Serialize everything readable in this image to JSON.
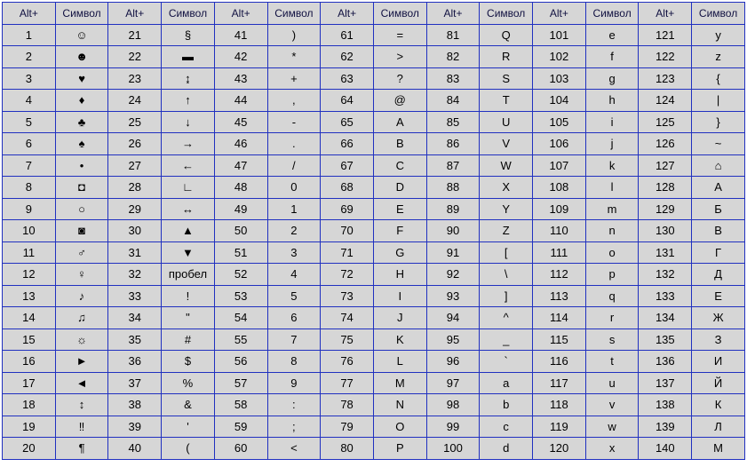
{
  "headers": {
    "code": "Alt+",
    "sym": "Символ"
  },
  "chart_data": {
    "type": "table",
    "title": "",
    "columns": [
      "Alt+",
      "Символ"
    ],
    "column_pairs": 7,
    "rows_per_pair": 20,
    "series": [
      {
        "code": "1",
        "sym": "☺"
      },
      {
        "code": "2",
        "sym": "☻"
      },
      {
        "code": "3",
        "sym": "♥"
      },
      {
        "code": "4",
        "sym": "♦"
      },
      {
        "code": "5",
        "sym": "♣"
      },
      {
        "code": "6",
        "sym": "♠"
      },
      {
        "code": "7",
        "sym": "•"
      },
      {
        "code": "8",
        "sym": "◘"
      },
      {
        "code": "9",
        "sym": "○"
      },
      {
        "code": "10",
        "sym": "◙"
      },
      {
        "code": "11",
        "sym": "♂"
      },
      {
        "code": "12",
        "sym": "♀"
      },
      {
        "code": "13",
        "sym": "♪"
      },
      {
        "code": "14",
        "sym": "♫"
      },
      {
        "code": "15",
        "sym": "☼"
      },
      {
        "code": "16",
        "sym": "►"
      },
      {
        "code": "17",
        "sym": "◄"
      },
      {
        "code": "18",
        "sym": "↕"
      },
      {
        "code": "19",
        "sym": "‼"
      },
      {
        "code": "20",
        "sym": "¶"
      },
      {
        "code": "21",
        "sym": "§"
      },
      {
        "code": "22",
        "sym": "▬"
      },
      {
        "code": "23",
        "sym": "↨"
      },
      {
        "code": "24",
        "sym": "↑"
      },
      {
        "code": "25",
        "sym": "↓"
      },
      {
        "code": "26",
        "sym": "→"
      },
      {
        "code": "27",
        "sym": "←"
      },
      {
        "code": "28",
        "sym": "∟"
      },
      {
        "code": "29",
        "sym": "↔"
      },
      {
        "code": "30",
        "sym": "▲"
      },
      {
        "code": "31",
        "sym": "▼"
      },
      {
        "code": "32",
        "sym": "пробел"
      },
      {
        "code": "33",
        "sym": "!"
      },
      {
        "code": "34",
        "sym": "\""
      },
      {
        "code": "35",
        "sym": "#"
      },
      {
        "code": "36",
        "sym": "$"
      },
      {
        "code": "37",
        "sym": "%"
      },
      {
        "code": "38",
        "sym": "&"
      },
      {
        "code": "39",
        "sym": "'"
      },
      {
        "code": "40",
        "sym": "("
      },
      {
        "code": "41",
        "sym": ")"
      },
      {
        "code": "42",
        "sym": "*"
      },
      {
        "code": "43",
        "sym": "+"
      },
      {
        "code": "44",
        "sym": ","
      },
      {
        "code": "45",
        "sym": "-"
      },
      {
        "code": "46",
        "sym": "."
      },
      {
        "code": "47",
        "sym": "/"
      },
      {
        "code": "48",
        "sym": "0"
      },
      {
        "code": "49",
        "sym": "1"
      },
      {
        "code": "50",
        "sym": "2"
      },
      {
        "code": "51",
        "sym": "3"
      },
      {
        "code": "52",
        "sym": "4"
      },
      {
        "code": "53",
        "sym": "5"
      },
      {
        "code": "54",
        "sym": "6"
      },
      {
        "code": "55",
        "sym": "7"
      },
      {
        "code": "56",
        "sym": "8"
      },
      {
        "code": "57",
        "sym": "9"
      },
      {
        "code": "58",
        "sym": ":"
      },
      {
        "code": "59",
        "sym": ";"
      },
      {
        "code": "60",
        "sym": "<"
      },
      {
        "code": "61",
        "sym": "="
      },
      {
        "code": "62",
        "sym": ">"
      },
      {
        "code": "63",
        "sym": "?"
      },
      {
        "code": "64",
        "sym": "@"
      },
      {
        "code": "65",
        "sym": "A"
      },
      {
        "code": "66",
        "sym": "B"
      },
      {
        "code": "67",
        "sym": "C"
      },
      {
        "code": "68",
        "sym": "D"
      },
      {
        "code": "69",
        "sym": "E"
      },
      {
        "code": "70",
        "sym": "F"
      },
      {
        "code": "71",
        "sym": "G"
      },
      {
        "code": "72",
        "sym": "H"
      },
      {
        "code": "73",
        "sym": "I"
      },
      {
        "code": "74",
        "sym": "J"
      },
      {
        "code": "75",
        "sym": "K"
      },
      {
        "code": "76",
        "sym": "L"
      },
      {
        "code": "77",
        "sym": "M"
      },
      {
        "code": "78",
        "sym": "N"
      },
      {
        "code": "79",
        "sym": "O"
      },
      {
        "code": "80",
        "sym": "P"
      },
      {
        "code": "81",
        "sym": "Q"
      },
      {
        "code": "82",
        "sym": "R"
      },
      {
        "code": "83",
        "sym": "S"
      },
      {
        "code": "84",
        "sym": "T"
      },
      {
        "code": "85",
        "sym": "U"
      },
      {
        "code": "86",
        "sym": "V"
      },
      {
        "code": "87",
        "sym": "W"
      },
      {
        "code": "88",
        "sym": "X"
      },
      {
        "code": "89",
        "sym": "Y"
      },
      {
        "code": "90",
        "sym": "Z"
      },
      {
        "code": "91",
        "sym": "["
      },
      {
        "code": "92",
        "sym": "\\"
      },
      {
        "code": "93",
        "sym": "]"
      },
      {
        "code": "94",
        "sym": "^"
      },
      {
        "code": "95",
        "sym": "_"
      },
      {
        "code": "96",
        "sym": "`"
      },
      {
        "code": "97",
        "sym": "a"
      },
      {
        "code": "98",
        "sym": "b"
      },
      {
        "code": "99",
        "sym": "c"
      },
      {
        "code": "100",
        "sym": "d"
      },
      {
        "code": "101",
        "sym": "e"
      },
      {
        "code": "102",
        "sym": "f"
      },
      {
        "code": "103",
        "sym": "g"
      },
      {
        "code": "104",
        "sym": "h"
      },
      {
        "code": "105",
        "sym": "i"
      },
      {
        "code": "106",
        "sym": "j"
      },
      {
        "code": "107",
        "sym": "k"
      },
      {
        "code": "108",
        "sym": "l"
      },
      {
        "code": "109",
        "sym": "m"
      },
      {
        "code": "110",
        "sym": "n"
      },
      {
        "code": "111",
        "sym": "o"
      },
      {
        "code": "112",
        "sym": "p"
      },
      {
        "code": "113",
        "sym": "q"
      },
      {
        "code": "114",
        "sym": "r"
      },
      {
        "code": "115",
        "sym": "s"
      },
      {
        "code": "116",
        "sym": "t"
      },
      {
        "code": "117",
        "sym": "u"
      },
      {
        "code": "118",
        "sym": "v"
      },
      {
        "code": "119",
        "sym": "w"
      },
      {
        "code": "120",
        "sym": "x"
      },
      {
        "code": "121",
        "sym": "y"
      },
      {
        "code": "122",
        "sym": "z"
      },
      {
        "code": "123",
        "sym": "{"
      },
      {
        "code": "124",
        "sym": "|"
      },
      {
        "code": "125",
        "sym": "}"
      },
      {
        "code": "126",
        "sym": "~"
      },
      {
        "code": "127",
        "sym": "⌂"
      },
      {
        "code": "128",
        "sym": "А"
      },
      {
        "code": "129",
        "sym": "Б"
      },
      {
        "code": "130",
        "sym": "В"
      },
      {
        "code": "131",
        "sym": "Г"
      },
      {
        "code": "132",
        "sym": "Д"
      },
      {
        "code": "133",
        "sym": "Е"
      },
      {
        "code": "134",
        "sym": "Ж"
      },
      {
        "code": "135",
        "sym": "З"
      },
      {
        "code": "136",
        "sym": "И"
      },
      {
        "code": "137",
        "sym": "Й"
      },
      {
        "code": "138",
        "sym": "К"
      },
      {
        "code": "139",
        "sym": "Л"
      },
      {
        "code": "140",
        "sym": "М"
      }
    ]
  }
}
